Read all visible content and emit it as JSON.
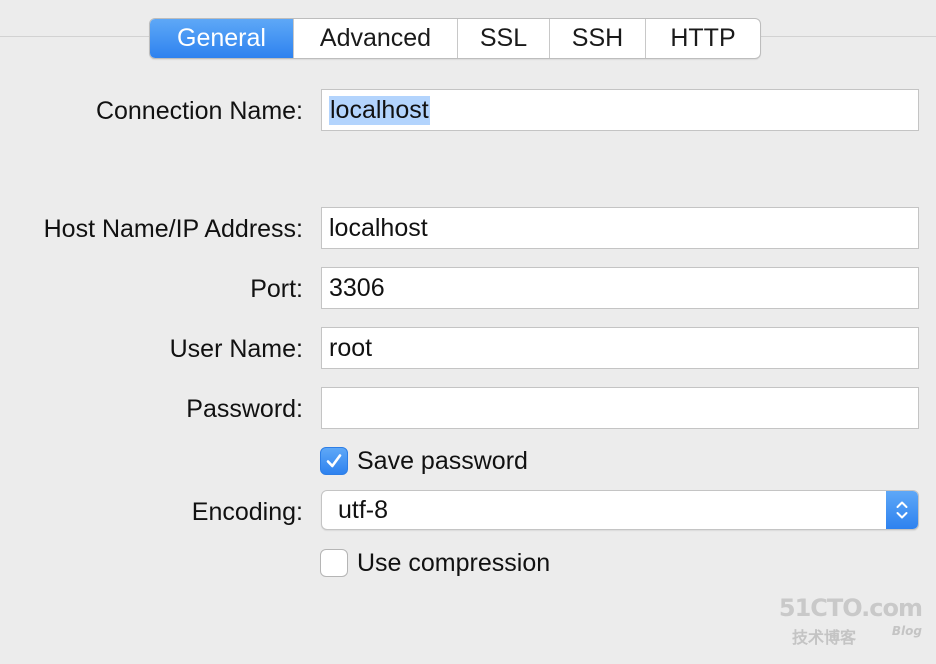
{
  "tabs": [
    {
      "label": "General",
      "active": true
    },
    {
      "label": "Advanced",
      "active": false
    },
    {
      "label": "SSL",
      "active": false
    },
    {
      "label": "SSH",
      "active": false
    },
    {
      "label": "HTTP",
      "active": false
    }
  ],
  "form": {
    "connection_name": {
      "label": "Connection Name:",
      "value": "localhost"
    },
    "host": {
      "label": "Host Name/IP Address:",
      "value": "localhost"
    },
    "port": {
      "label": "Port:",
      "value": "3306"
    },
    "user": {
      "label": "User Name:",
      "value": "root"
    },
    "password": {
      "label": "Password:",
      "value": ""
    },
    "save_password": {
      "label": "Save password",
      "checked": true
    },
    "encoding": {
      "label": "Encoding:",
      "value": "utf-8"
    },
    "compression": {
      "label": "Use compression",
      "checked": false
    }
  },
  "watermark": {
    "main": "51CTO.com",
    "sub": "技术博客",
    "blog": "Blog"
  },
  "colors": {
    "accent": "#2e82ef",
    "selection": "#b3d4fd",
    "background": "#ececec"
  }
}
